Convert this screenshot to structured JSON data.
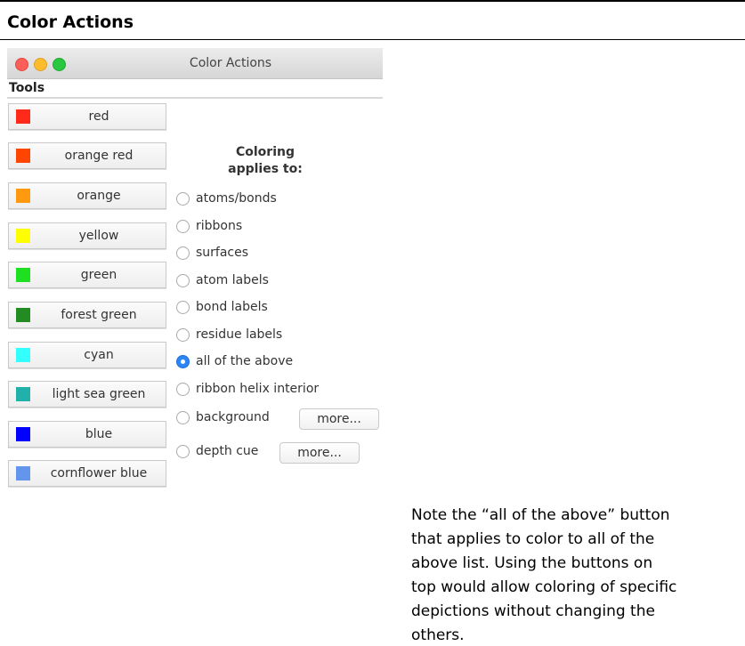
{
  "page": {
    "title": "Color Actions",
    "note_lines": [
      "Note the “all of the above” button",
      "that applies to color to all of the",
      "above list. Using the buttons on",
      "top would allow coloring of specific",
      "depictions without changing the",
      "others."
    ]
  },
  "window": {
    "title": "Color Actions",
    "tools_label": "Tools"
  },
  "color_buttons": [
    {
      "label": "red",
      "swatch": "#ff2a1a"
    },
    {
      "label": "orange red",
      "swatch": "#ff4500"
    },
    {
      "label": "orange",
      "swatch": "#ff9a10"
    },
    {
      "label": "yellow",
      "swatch": "#ffff00"
    },
    {
      "label": "green",
      "swatch": "#1fe020"
    },
    {
      "label": "forest green",
      "swatch": "#228b22"
    },
    {
      "label": "cyan",
      "swatch": "#33ffff"
    },
    {
      "label": "light sea green",
      "swatch": "#20b2aa"
    },
    {
      "label": "blue",
      "swatch": "#0000ff"
    },
    {
      "label": "cornflower blue",
      "swatch": "#6495ed"
    }
  ],
  "coloring": {
    "heading_line1": "Coloring",
    "heading_line2": "applies to:",
    "options": [
      {
        "label": "atoms/bonds",
        "checked": false
      },
      {
        "label": "ribbons",
        "checked": false
      },
      {
        "label": "surfaces",
        "checked": false
      },
      {
        "label": "atom labels",
        "checked": false
      },
      {
        "label": "bond labels",
        "checked": false
      },
      {
        "label": "residue labels",
        "checked": false
      },
      {
        "label": "all of the above",
        "checked": true
      },
      {
        "label": "ribbon helix interior",
        "checked": false
      },
      {
        "label": "background",
        "checked": false
      },
      {
        "label": "depth cue",
        "checked": false
      }
    ],
    "more_label": "more..."
  }
}
